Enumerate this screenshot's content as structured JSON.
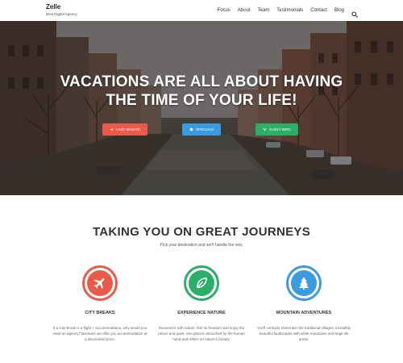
{
  "brand": {
    "name": "Zelle",
    "tagline": "Best Digital Agency"
  },
  "nav": {
    "items": [
      "Focus",
      "About",
      "Team",
      "Testimonials",
      "Contact",
      "Blog"
    ],
    "search_icon": "search-icon"
  },
  "hero": {
    "title_line1": "VACATIONS ARE ALL ABOUT HAVING",
    "title_line2": "THE TIME OF YOUR LIFE!",
    "buttons": [
      {
        "label": "LAST MINUTE",
        "icon": "plane-icon",
        "color": "#e95a4a"
      },
      {
        "label": "SPECIALS",
        "icon": "star-icon",
        "color": "#3a9be0"
      },
      {
        "label": "EARLY BIRD",
        "icon": "bird-icon",
        "color": "#2aae68"
      }
    ]
  },
  "section": {
    "title": "TAKING YOU ON GREAT JOURNEYS",
    "subtitle": "Pick your destination and we'll handle the rest."
  },
  "features": [
    {
      "title": "CITY BREAKS",
      "text": "If a City Break is a flight + accommodation, why would you need an agency? Because we offer you accommodation at a discounted price.",
      "icon": "airplane-icon",
      "color": "#e95a4a"
    },
    {
      "title": "EXPERIENCE NATURE",
      "text": "Reconnect with nature, feel its freedom and enjoy the peace and quiet. See places untouched by the human hand and reflect on nature's beauty.",
      "icon": "leaf-icon",
      "color": "#2aae68"
    },
    {
      "title": "MOUNTAIN ADVENTURES",
      "text": "You'll certainly remember the traditional villages, incredibly beautiful landscapes with white mountains and huge ski areas.",
      "icon": "pine-tree-icon",
      "color": "#3a9be0"
    }
  ]
}
